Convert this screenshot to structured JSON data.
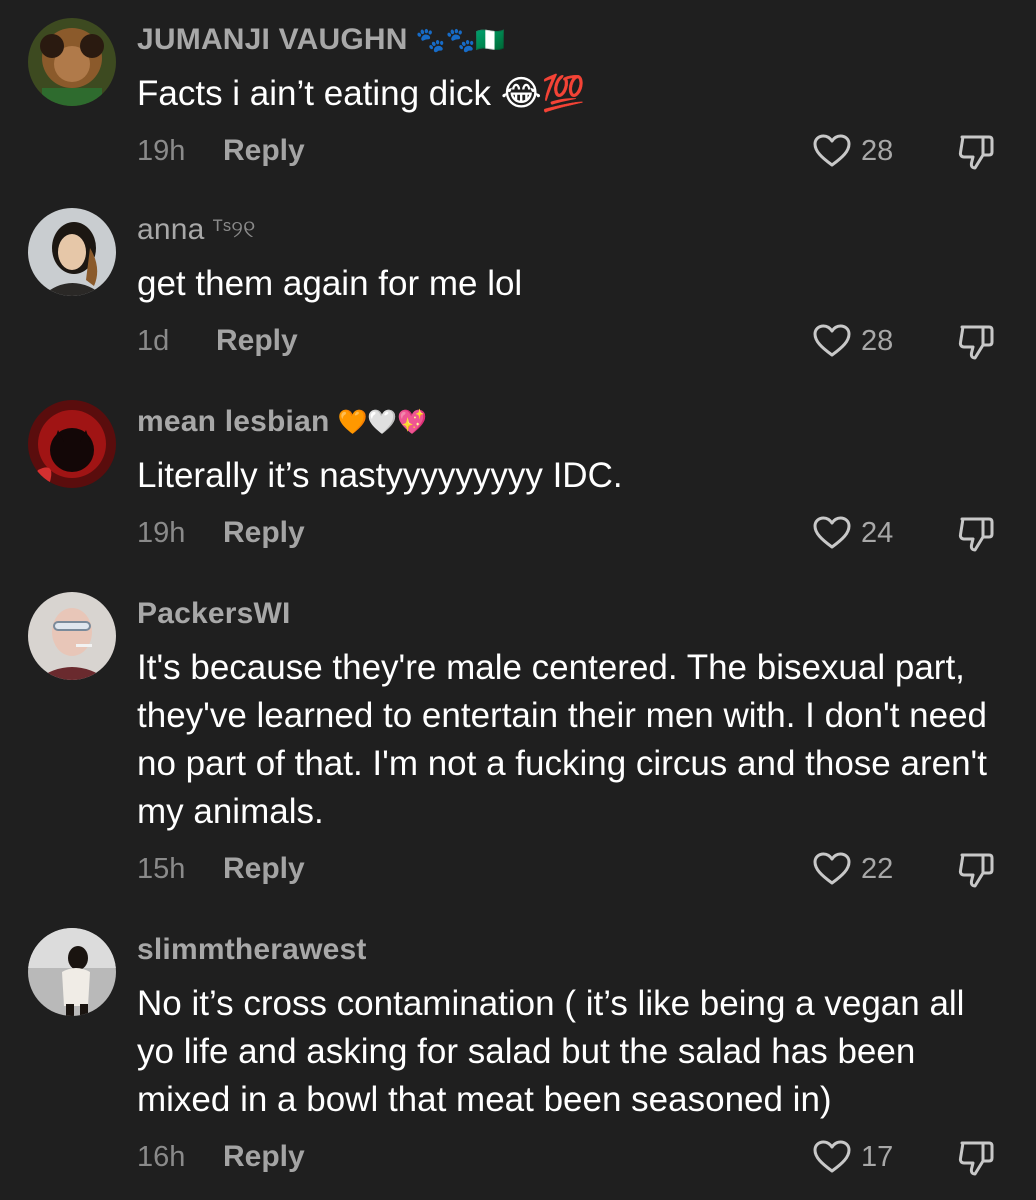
{
  "comments": [
    {
      "username": "JUMANJI VAUGHN",
      "badge": "🐾🐾🇳🇬",
      "text": "Facts i ain’t eating dick 😂💯",
      "time": "19h",
      "reply_label": "Reply",
      "likes": "28"
    },
    {
      "username": "anna",
      "badge": "ᵀˢ୨୧",
      "text": "get them again for me lol",
      "time": "1d",
      "reply_label": "Reply",
      "likes": "28"
    },
    {
      "username": "mean lesbian",
      "badge": "🧡🤍💖",
      "text": "Literally it’s nastyyyyyyyyy IDC.",
      "time": "19h",
      "reply_label": "Reply",
      "likes": "24"
    },
    {
      "username": "PackersWI",
      "badge": "",
      "text": "It's because they're male centered. The bisexual part, they've learned to entertain their men with. I don't need no part of that. I'm not a fucking circus and those aren't my animals.",
      "time": "15h",
      "reply_label": "Reply",
      "likes": "22"
    },
    {
      "username": "slimmtherawest",
      "badge": "",
      "text": "No it’s cross contamination ( it’s like being a vegan all yo life and asking for salad but the salad has been mixed in a bowl that meat been seasoned in)",
      "time": "16h",
      "reply_label": "Reply",
      "likes": "17"
    }
  ],
  "colors": {
    "background": "#1f1f1f",
    "username": "#a8a8a8",
    "text": "#ffffff",
    "meta": "#8a8a8a",
    "icon": "#c8c8c8"
  },
  "icons": {
    "like": "heart-icon",
    "dislike": "thumbs-down-icon"
  }
}
